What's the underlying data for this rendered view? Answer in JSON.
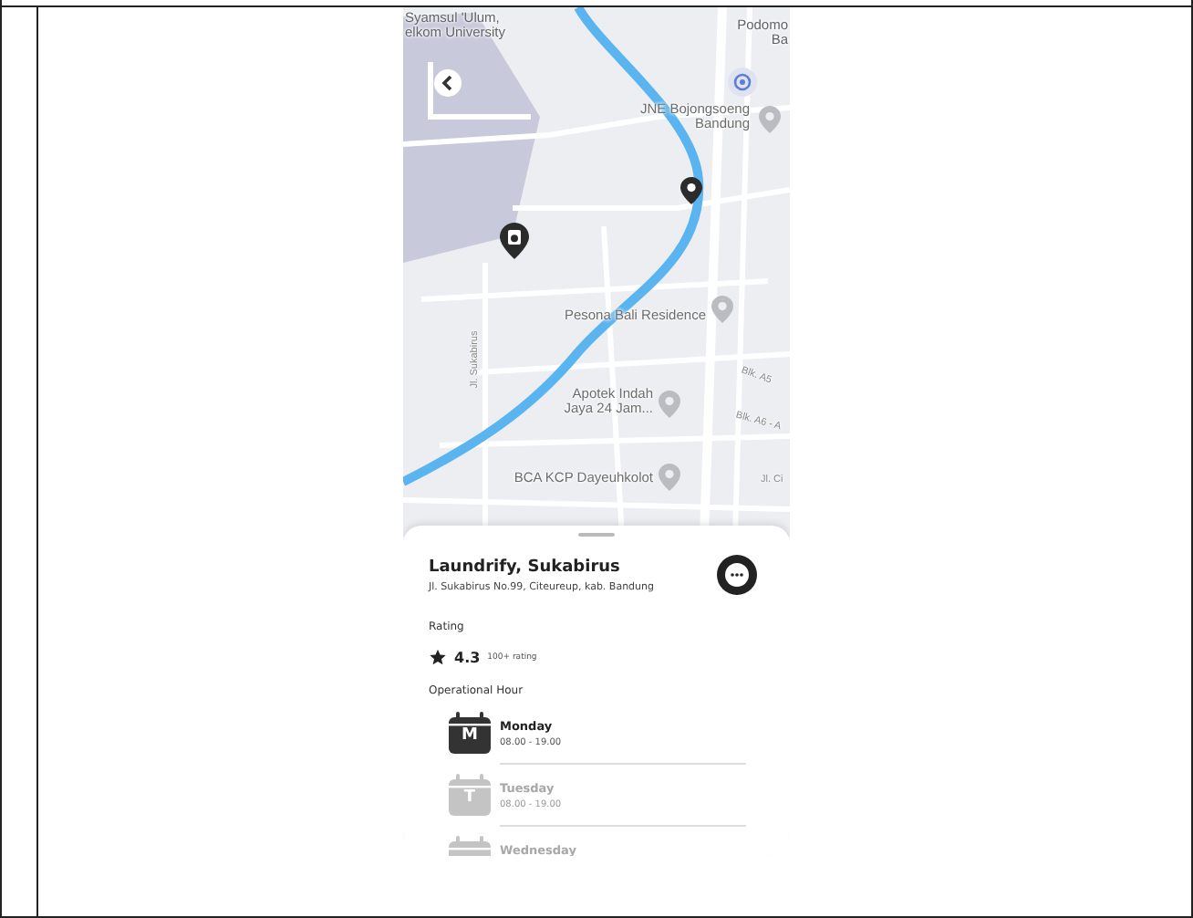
{
  "map": {
    "labels": [
      {
        "text": "Syamsul 'Ulum,\nelkom University",
        "kind": "place"
      },
      {
        "text": "Podomo\nBa",
        "kind": "place"
      },
      {
        "text": "JNE Bojongsoeng\nBandung",
        "kind": "poi"
      },
      {
        "text": "Jl. Sukabirus",
        "kind": "street"
      },
      {
        "text": "Pesona Bali Residence",
        "kind": "poi"
      },
      {
        "text": "Apotek Indah\nJaya 24 Jam...",
        "kind": "poi"
      },
      {
        "text": "BCA KCP Dayeuhkolot",
        "kind": "poi"
      },
      {
        "text": "Blk. A5",
        "kind": "street"
      },
      {
        "text": "Blk. A6 - A",
        "kind": "street"
      },
      {
        "text": "Jl. Ci",
        "kind": "street"
      }
    ]
  },
  "place": {
    "name": "Laundrify, Sukabirus",
    "address": "Jl. Sukabirus No.99, Citeureup, kab. Bandung"
  },
  "rating": {
    "heading": "Rating",
    "value": "4.3",
    "count": "100+ rating"
  },
  "hours": {
    "heading": "Operational Hour",
    "days": [
      {
        "letter": "M",
        "day": "Monday",
        "time": "08.00 - 19.00",
        "selected": true
      },
      {
        "letter": "T",
        "day": "Tuesday",
        "time": "08.00 - 19.00",
        "selected": false
      },
      {
        "day": "Wednesday",
        "selected": false
      }
    ]
  }
}
